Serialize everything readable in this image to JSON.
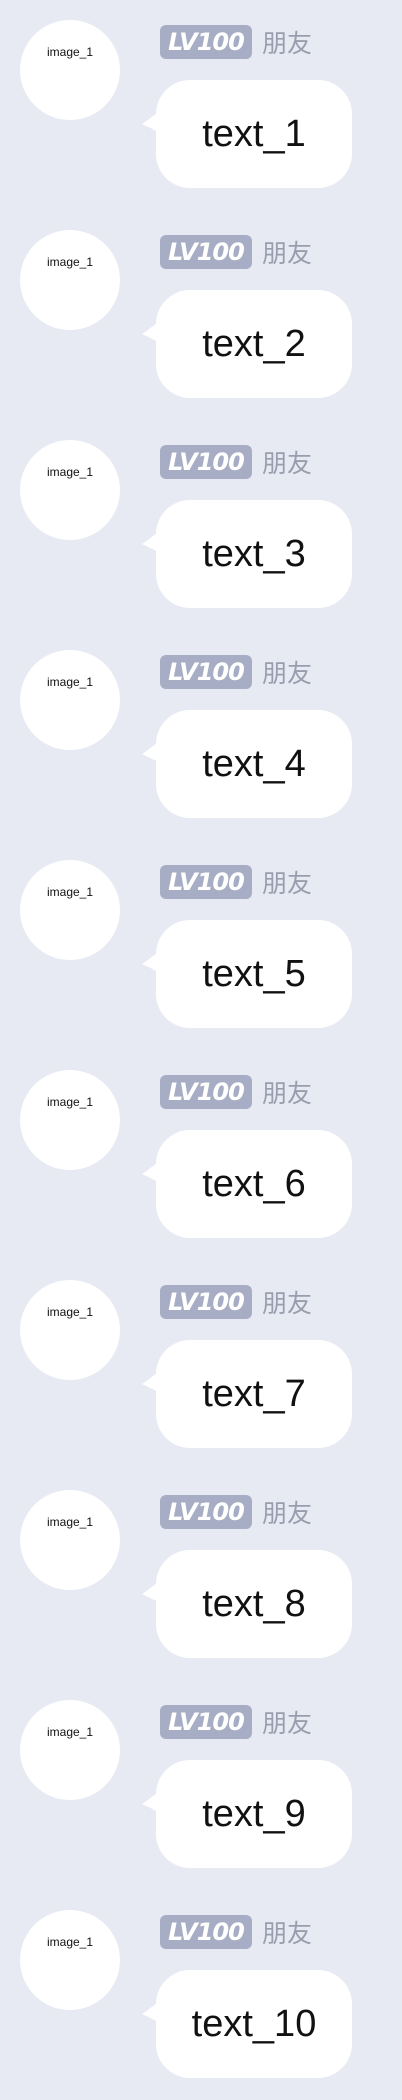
{
  "messages": [
    {
      "avatar": "image_1",
      "level": "LV100",
      "name": "朋友",
      "text": "text_1"
    },
    {
      "avatar": "image_1",
      "level": "LV100",
      "name": "朋友",
      "text": "text_2"
    },
    {
      "avatar": "image_1",
      "level": "LV100",
      "name": "朋友",
      "text": "text_3"
    },
    {
      "avatar": "image_1",
      "level": "LV100",
      "name": "朋友",
      "text": "text_4"
    },
    {
      "avatar": "image_1",
      "level": "LV100",
      "name": "朋友",
      "text": "text_5"
    },
    {
      "avatar": "image_1",
      "level": "LV100",
      "name": "朋友",
      "text": "text_6"
    },
    {
      "avatar": "image_1",
      "level": "LV100",
      "name": "朋友",
      "text": "text_7"
    },
    {
      "avatar": "image_1",
      "level": "LV100",
      "name": "朋友",
      "text": "text_8"
    },
    {
      "avatar": "image_1",
      "level": "LV100",
      "name": "朋友",
      "text": "text_9"
    },
    {
      "avatar": "image_1",
      "level": "LV100",
      "name": "朋友",
      "text": "text_10"
    }
  ],
  "colors": {
    "background": "#e7eaf3",
    "bubble": "#ffffff",
    "level_badge": "#a6adc4",
    "name_text": "#999eae"
  }
}
